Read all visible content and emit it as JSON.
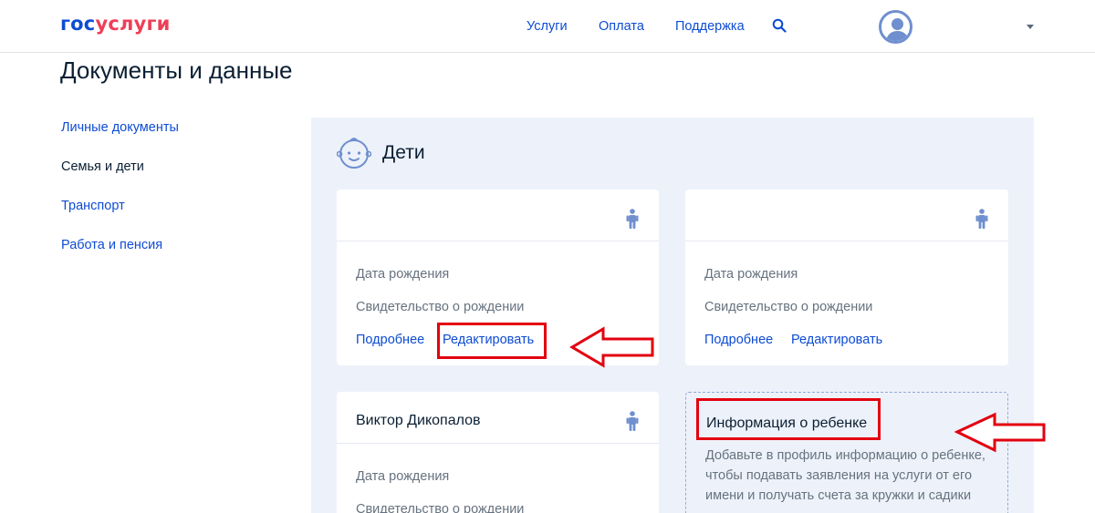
{
  "header": {
    "logo_part1": "гос",
    "logo_part2": "услуги",
    "nav": [
      "Услуги",
      "Оплата",
      "Поддержка"
    ]
  },
  "page": {
    "title": "Документы и данные"
  },
  "sidebar": {
    "items": [
      {
        "label": "Личные документы",
        "active": false
      },
      {
        "label": "Семья и дети",
        "active": true
      },
      {
        "label": "Транспорт",
        "active": false
      },
      {
        "label": "Работа и пенсия",
        "active": false
      }
    ]
  },
  "section": {
    "title": "Дети"
  },
  "cards": [
    {
      "name": "",
      "birth_label": "Дата рождения",
      "cert_label": "Свидетельство о рождении",
      "details_link": "Подробнее",
      "edit_link": "Редактировать"
    },
    {
      "name": "",
      "birth_label": "Дата рождения",
      "cert_label": "Свидетельство о рождении",
      "details_link": "Подробнее",
      "edit_link": "Редактировать"
    },
    {
      "name": "Виктор Дикопалов",
      "birth_label": "Дата рождения",
      "cert_label": "Свидетельство о рождении"
    }
  ],
  "info_card": {
    "title": "Информация о ребенке",
    "text": "Добавьте в профиль информацию о ребенке, чтобы подавать заявления на услуги от его имени и получать счета за кружки и садики"
  },
  "colors": {
    "brand_blue": "#0d4cd3",
    "brand_red": "#ee3f58",
    "annotation_red": "#e3000f",
    "panel_bg": "#edf2fa",
    "icon_blue": "#6f8fcf"
  }
}
